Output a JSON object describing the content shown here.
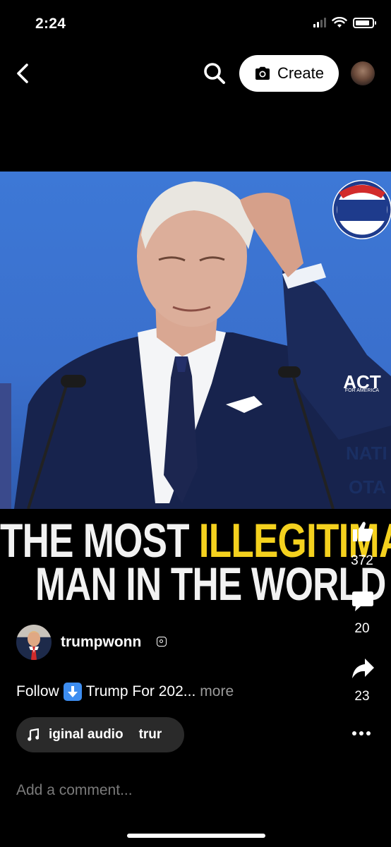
{
  "status_bar": {
    "time": "2:24",
    "icons": [
      "cellular-signal-icon",
      "wifi-icon",
      "battery-icon"
    ]
  },
  "top_nav": {
    "back_icon": "chevron-left-icon",
    "search_icon": "search-icon",
    "create_label": "Create",
    "create_icon": "camera-icon",
    "profile_icon": "avatar"
  },
  "video": {
    "logo_text": "ACT",
    "logo_subtext": "FOR AMERICA",
    "background_sign_text": [
      "NATI",
      "OTA"
    ],
    "caption_line1_white": "THE MOST ",
    "caption_line1_yellow": "ILLEGITIMATE",
    "caption_line2": "MAN IN THE WORLD"
  },
  "rail": {
    "likes": "372",
    "comments": "20",
    "shares": "23",
    "icons": [
      "thumbs-up-icon",
      "comment-icon",
      "share-icon",
      "more-icon"
    ]
  },
  "author": {
    "username": "trumpwonn",
    "badge_icon": "instagram-icon"
  },
  "description": {
    "prefix": "Follow",
    "emoji_icon": "down-arrow-emoji-icon",
    "text": "Trump For 202...",
    "more_label": "more"
  },
  "audio": {
    "icon": "music-note-icon",
    "label": "iginal audio",
    "artist": "trur"
  },
  "comment_input": {
    "placeholder": "Add a comment..."
  },
  "colors": {
    "background": "#000000",
    "caption_yellow": "#f4d11e",
    "video_bg_blue": "#3a6fcc",
    "pill_bg": "#2a2a2a",
    "muted_text": "#9a9a9a"
  }
}
